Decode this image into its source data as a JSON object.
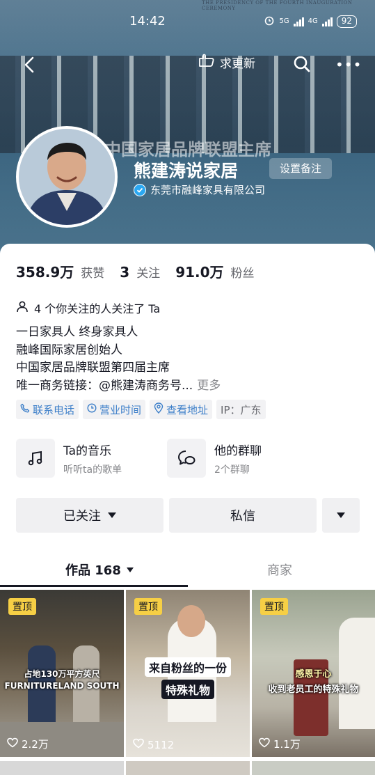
{
  "status_bar": {
    "time": "14:42",
    "battery": "92",
    "network_1": "5G",
    "network_2": "4G"
  },
  "nav": {
    "update_label": "求更新",
    "icons": [
      "back-arrow-icon",
      "ask-update-icon",
      "search-icon",
      "more-dots-icon"
    ]
  },
  "banner": {
    "stage_text": "中国家居品牌联盟主席",
    "top_text": "THE PRESIDENCY OF THE FOURTH INAUGURATION CEREMONY"
  },
  "profile": {
    "name": "熊建涛说家居",
    "remark_button": "设置备注",
    "verified_company": "东莞市融峰家具有限公司",
    "stats": {
      "likes_value": "358.9万",
      "likes_label": "获赞",
      "following_value": "3",
      "following_label": "关注",
      "followers_value": "91.0万",
      "followers_label": "粉丝"
    },
    "mutual_text": "4 个你关注的人关注了 Ta",
    "bio_lines": [
      "一日家具人  终身家具人",
      "融峰国际家居创始人",
      "中国家居品牌联盟第四届主席",
      "唯一商务链接：@熊建涛商务号..."
    ],
    "bio_more": "更多",
    "tags": [
      {
        "label": "联系电话",
        "icon": "phone-icon"
      },
      {
        "label": "营业时间",
        "icon": "clock-icon"
      },
      {
        "label": "查看地址",
        "icon": "location-pin-icon"
      },
      {
        "label": "IP：广东",
        "icon": ""
      }
    ]
  },
  "features": [
    {
      "title": "Ta的音乐",
      "subtitle": "听听ta的歌单",
      "icon": "music-note-icon"
    },
    {
      "title": "他的群聊",
      "subtitle": "2个群聊",
      "icon": "group-chat-icon"
    }
  ],
  "actions": {
    "follow_label": "已关注",
    "message_label": "私信"
  },
  "tabs": {
    "works_label": "作品 168",
    "shop_label": "商家"
  },
  "videos": [
    {
      "pinned": "置顶",
      "caption_lines": [
        "占地130万平方英尺",
        "FURNITURELAND SOUTH"
      ],
      "likes": "2.2万"
    },
    {
      "pinned": "置顶",
      "caption_lines": [
        "来自粉丝的一份",
        "特殊礼物"
      ],
      "likes": "5112"
    },
    {
      "pinned": "置顶",
      "caption_lines": [
        "感恩于心",
        "收到老员工的特殊礼物"
      ],
      "likes": "1.1万"
    }
  ],
  "colors": {
    "accent_link": "#3d7fc9",
    "verify_badge": "#2aa8f2",
    "pin_badge": "#f6cf45",
    "primary_text": "#161823",
    "secondary_text": "#86878b"
  }
}
